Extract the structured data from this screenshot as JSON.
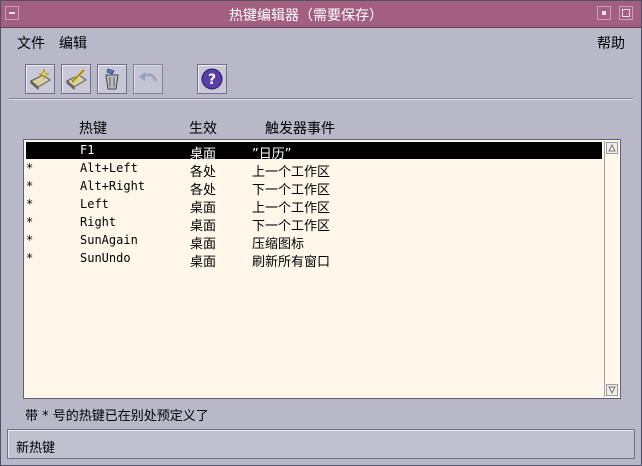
{
  "window": {
    "title": "热键编辑器（需要保存）"
  },
  "menubar": {
    "file": "文件",
    "edit": "编辑",
    "help": "帮助"
  },
  "toolbar": {
    "buttons": [
      {
        "icon": "new-hotkey-icon"
      },
      {
        "icon": "edit-hotkey-icon"
      },
      {
        "icon": "delete-trash-icon"
      },
      {
        "icon": "undo-arrow-icon"
      },
      {
        "icon": "help-question-icon"
      }
    ]
  },
  "columns": {
    "hotkey": "热键",
    "effect": "生效",
    "trigger": "触发器事件"
  },
  "rows": [
    {
      "mark": "",
      "key": "F1",
      "scope": "桌面",
      "event": "”日历”",
      "selected": true
    },
    {
      "mark": "*",
      "key": "Alt+Left",
      "scope": "各处",
      "event": "上一个工作区",
      "selected": false
    },
    {
      "mark": "*",
      "key": "Alt+Right",
      "scope": "各处",
      "event": "下一个工作区",
      "selected": false
    },
    {
      "mark": "*",
      "key": "Left",
      "scope": "桌面",
      "event": "上一个工作区",
      "selected": false
    },
    {
      "mark": "*",
      "key": "Right",
      "scope": "桌面",
      "event": "下一个工作区",
      "selected": false
    },
    {
      "mark": "*",
      "key": "SunAgain",
      "scope": "桌面",
      "event": "压缩图标",
      "selected": false
    },
    {
      "mark": "*",
      "key": "SunUndo",
      "scope": "桌面",
      "event": "刷新所有窗口",
      "selected": false
    }
  ],
  "footnote": "带 * 号的热键已在别处预定义了",
  "status": "新热键",
  "colors": {
    "titlebar": "#a35f80",
    "window_bg": "#b8b8c8",
    "list_bg": "#fff7ea",
    "selection": "#000000"
  }
}
